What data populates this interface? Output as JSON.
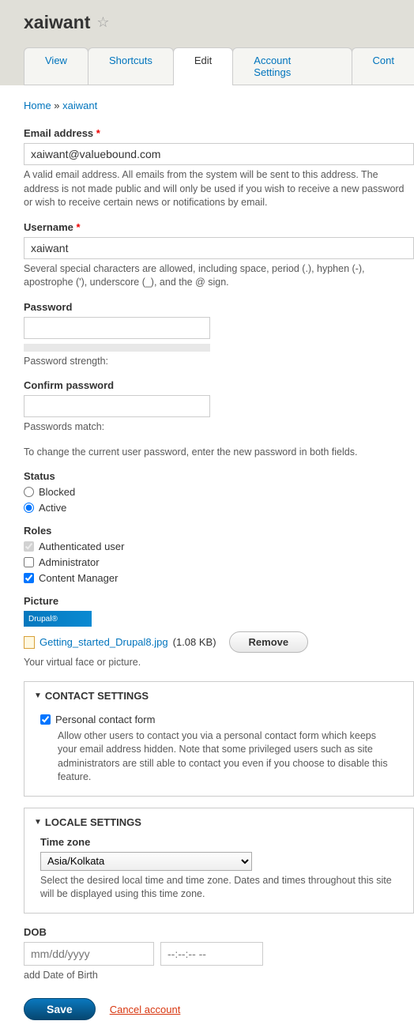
{
  "header": {
    "title": "xaiwant"
  },
  "tabs": {
    "view": "View",
    "shortcuts": "Shortcuts",
    "edit": "Edit",
    "account_settings": "Account Settings",
    "cont": "Cont"
  },
  "breadcrumb": {
    "home": "Home",
    "sep": " » ",
    "current": "xaiwant"
  },
  "email": {
    "label": "Email address",
    "value": "xaiwant@valuebound.com",
    "desc": "A valid email address. All emails from the system will be sent to this address. The address is not made public and will only be used if you wish to receive a new password or wish to receive certain news or notifications by email."
  },
  "username": {
    "label": "Username",
    "value": "xaiwant",
    "desc": "Several special characters are allowed, including space, period (.), hyphen (-), apostrophe ('), underscore (_), and the @ sign."
  },
  "password": {
    "label": "Password",
    "strength_label": "Password strength:"
  },
  "confirm": {
    "label": "Confirm password",
    "match_label": "Passwords match:",
    "desc": "To change the current user password, enter the new password in both fields."
  },
  "status": {
    "label": "Status",
    "blocked": "Blocked",
    "active": "Active"
  },
  "roles": {
    "label": "Roles",
    "auth": "Authenticated user",
    "admin": "Administrator",
    "cm": "Content Manager"
  },
  "picture": {
    "label": "Picture",
    "thumb_text": "Drupal®",
    "file_name": "Getting_started_Drupal8.jpg",
    "file_size": "(1.08 KB)",
    "remove": "Remove",
    "desc": "Your virtual face or picture."
  },
  "contact": {
    "legend": "CONTACT SETTINGS",
    "checkbox": "Personal contact form",
    "desc": "Allow other users to contact you via a personal contact form which keeps your email address hidden. Note that some privileged users such as site administrators are still able to contact you even if you choose to disable this feature."
  },
  "locale": {
    "legend": "LOCALE SETTINGS",
    "tz_label": "Time zone",
    "tz_value": "Asia/Kolkata",
    "desc": "Select the desired local time and time zone. Dates and times throughout this site will be displayed using this time zone."
  },
  "dob": {
    "label": "DOB",
    "date_ph": "mm/dd/yyyy",
    "time_ph": "--:--:-- --",
    "desc": "add Date of Birth"
  },
  "actions": {
    "save": "Save",
    "cancel": "Cancel account"
  }
}
